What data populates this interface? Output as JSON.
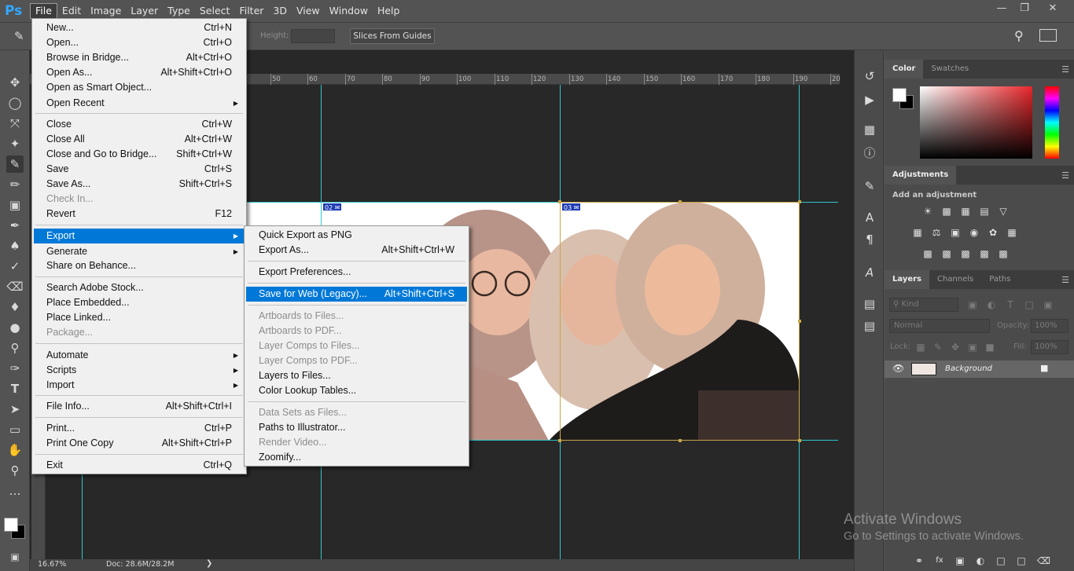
{
  "app": {
    "logo": "Ps",
    "menus": [
      "File",
      "Edit",
      "Image",
      "Layer",
      "Type",
      "Select",
      "Filter",
      "3D",
      "View",
      "Window",
      "Help"
    ],
    "window_controls": [
      "minimize",
      "restore",
      "close"
    ]
  },
  "options_bar": {
    "height_label": "Height:",
    "slices_button": "Slices From Guides"
  },
  "ruler": {
    "ticks": [
      "50",
      "60",
      "70",
      "80",
      "90",
      "100",
      "110",
      "120",
      "130",
      "140",
      "150",
      "160",
      "170",
      "180",
      "190",
      "20"
    ]
  },
  "slices": {
    "tag_02": "02",
    "tag_03": "03"
  },
  "status": {
    "zoom": "16.67%",
    "doc": "Doc: 28.6M/28.2M"
  },
  "panels": {
    "color_tabs": [
      "Color",
      "Swatches"
    ],
    "adjustments_title": "Adjustments",
    "add_adjustment": "Add an adjustment",
    "layers_tabs": [
      "Layers",
      "Channels",
      "Paths"
    ],
    "kind_filter": "Kind",
    "blend_mode": "Normal",
    "opacity_label": "Opacity:",
    "opacity_value": "100%",
    "lock_label": "Lock:",
    "fill_label": "Fill:",
    "fill_value": "100%",
    "layer_name": "Background",
    "foreground_color": "#ffffff",
    "background_color": "#000000"
  },
  "file_menu": {
    "items": [
      {
        "label": "New...",
        "shortcut": "Ctrl+N"
      },
      {
        "label": "Open...",
        "shortcut": "Ctrl+O"
      },
      {
        "label": "Browse in Bridge...",
        "shortcut": "Alt+Ctrl+O"
      },
      {
        "label": "Open As...",
        "shortcut": "Alt+Shift+Ctrl+O"
      },
      {
        "label": "Open as Smart Object...",
        "shortcut": ""
      },
      {
        "label": "Open Recent",
        "shortcut": ""
      },
      {
        "label": "Close",
        "shortcut": "Ctrl+W"
      },
      {
        "label": "Close All",
        "shortcut": "Alt+Ctrl+W"
      },
      {
        "label": "Close and Go to Bridge...",
        "shortcut": "Shift+Ctrl+W"
      },
      {
        "label": "Save",
        "shortcut": "Ctrl+S"
      },
      {
        "label": "Save As...",
        "shortcut": "Shift+Ctrl+S"
      },
      {
        "label": "Check In...",
        "shortcut": ""
      },
      {
        "label": "Revert",
        "shortcut": "F12"
      },
      {
        "label": "Export",
        "shortcut": ""
      },
      {
        "label": "Generate",
        "shortcut": ""
      },
      {
        "label": "Share on Behance...",
        "shortcut": ""
      },
      {
        "label": "Search Adobe Stock...",
        "shortcut": ""
      },
      {
        "label": "Place Embedded...",
        "shortcut": ""
      },
      {
        "label": "Place Linked...",
        "shortcut": ""
      },
      {
        "label": "Package...",
        "shortcut": ""
      },
      {
        "label": "Automate",
        "shortcut": ""
      },
      {
        "label": "Scripts",
        "shortcut": ""
      },
      {
        "label": "Import",
        "shortcut": ""
      },
      {
        "label": "File Info...",
        "shortcut": "Alt+Shift+Ctrl+I"
      },
      {
        "label": "Print...",
        "shortcut": "Ctrl+P"
      },
      {
        "label": "Print One Copy",
        "shortcut": "Alt+Shift+Ctrl+P"
      },
      {
        "label": "Exit",
        "shortcut": "Ctrl+Q"
      }
    ]
  },
  "export_menu": {
    "items": [
      {
        "label": "Quick Export as PNG",
        "shortcut": ""
      },
      {
        "label": "Export As...",
        "shortcut": "Alt+Shift+Ctrl+W"
      },
      {
        "label": "Export Preferences...",
        "shortcut": ""
      },
      {
        "label": "Save for Web (Legacy)...",
        "shortcut": "Alt+Shift+Ctrl+S"
      },
      {
        "label": "Artboards to Files...",
        "shortcut": ""
      },
      {
        "label": "Artboards to PDF...",
        "shortcut": ""
      },
      {
        "label": "Layer Comps to Files...",
        "shortcut": ""
      },
      {
        "label": "Layer Comps to PDF...",
        "shortcut": ""
      },
      {
        "label": "Layers to Files...",
        "shortcut": ""
      },
      {
        "label": "Color Lookup Tables...",
        "shortcut": ""
      },
      {
        "label": "Data Sets as Files...",
        "shortcut": ""
      },
      {
        "label": "Paths to Illustrator...",
        "shortcut": ""
      },
      {
        "label": "Render Video...",
        "shortcut": ""
      },
      {
        "label": "Zoomify...",
        "shortcut": ""
      }
    ]
  },
  "watermark": {
    "line1": "Activate Windows",
    "line2": "Go to Settings to activate Windows."
  }
}
